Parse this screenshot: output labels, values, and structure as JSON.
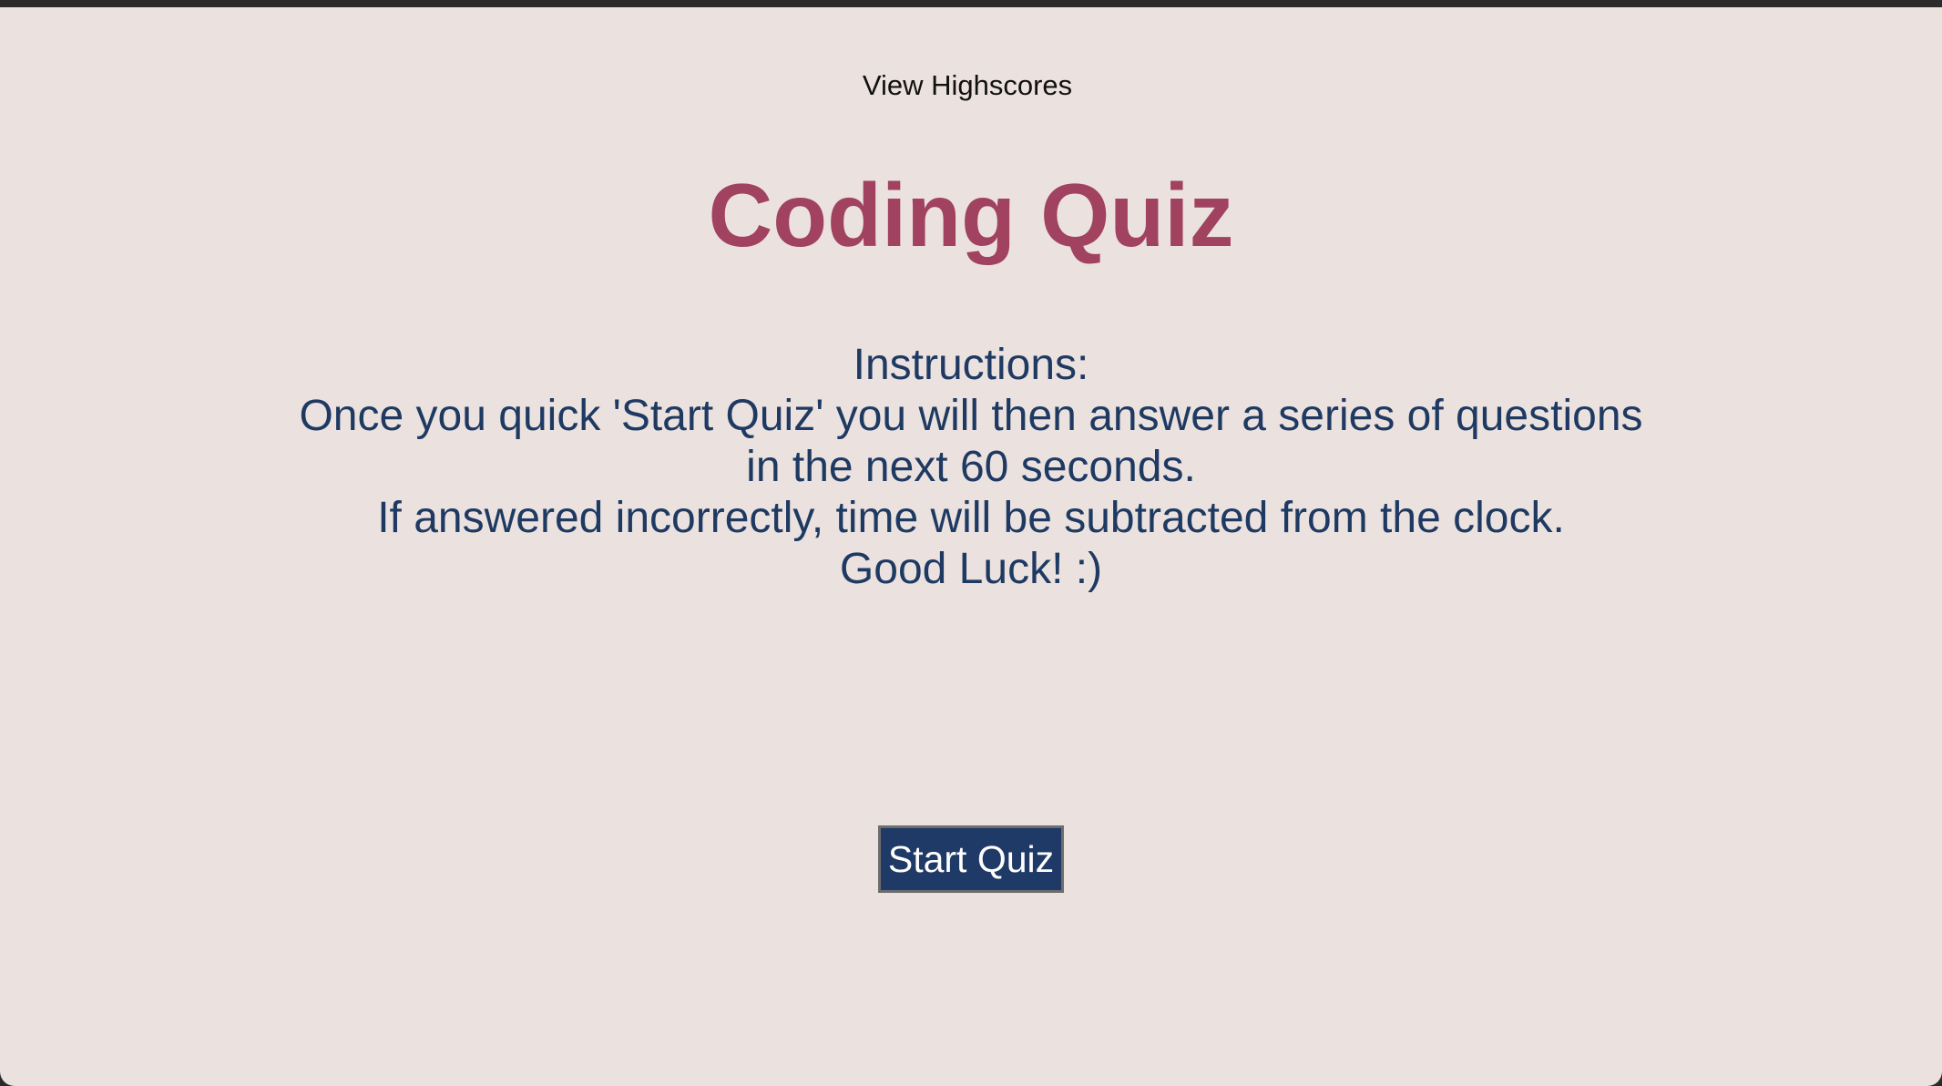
{
  "header": {
    "highscores_link": "View Highscores"
  },
  "main": {
    "title": "Coding Quiz",
    "instructions": [
      "Instructions:",
      "Once you quick 'Start Quiz' you will then answer a series of questions",
      "in the next 60 seconds.",
      "If answered incorrectly, time will be subtracted from the clock.",
      "Good Luck! :)"
    ],
    "start_button": "Start Quiz"
  },
  "colors": {
    "background": "#ebe2df",
    "title": "#a04260",
    "instructions_text": "#1f3a62",
    "button_bg": "#1f3a66",
    "button_text": "#ffffff"
  }
}
